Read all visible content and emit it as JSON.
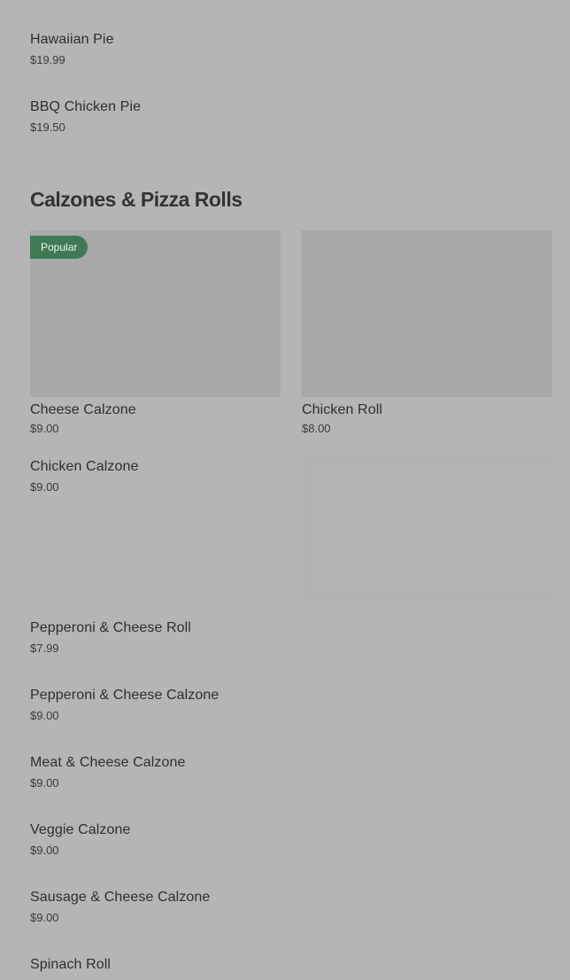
{
  "previous_section": {
    "items": [
      {
        "name": "Hawaiian Pie",
        "price": "$19.99"
      },
      {
        "name": "BBQ Chicken Pie",
        "price": "$19.50"
      }
    ]
  },
  "section": {
    "title": "Calzones & Pizza Rolls",
    "featured": [
      {
        "name": "Cheese Calzone",
        "price": "$9.00",
        "badge": "Popular"
      },
      {
        "name": "Chicken Roll",
        "price": "$8.00"
      }
    ],
    "items": [
      {
        "name": "Chicken Calzone",
        "price": "$9.00"
      },
      {
        "name": "Pepperoni & Cheese Roll",
        "price": "$7.99"
      },
      {
        "name": "Pepperoni & Cheese Calzone",
        "price": "$9.00"
      },
      {
        "name": "Meat & Cheese Calzone",
        "price": "$9.00"
      },
      {
        "name": "Veggie Calzone",
        "price": "$9.00"
      },
      {
        "name": "Sausage & Cheese Calzone",
        "price": "$9.00"
      },
      {
        "name": "Spinach Roll",
        "price": ""
      }
    ]
  },
  "colors": {
    "background": "#b5b5b5",
    "image_placeholder": "#a9a9a9",
    "badge": "#3f7a55",
    "text": "#2e2e2e"
  }
}
